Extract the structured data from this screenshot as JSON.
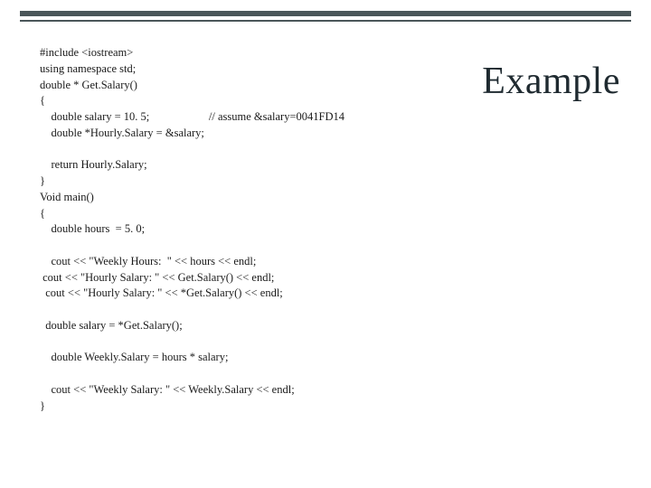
{
  "slide": {
    "title": "Example",
    "code_lines": [
      "#include <iostream>",
      "using namespace std;",
      "double * Get.Salary()",
      "{",
      "    double salary = 10. 5;                     // assume &salary=0041FD14",
      "    double *Hourly.Salary = &salary;",
      "",
      "    return Hourly.Salary;",
      "}",
      "Void main()",
      "{",
      "    double hours  = 5. 0;",
      "",
      "    cout << \"Weekly Hours:  \" << hours << endl;",
      " cout << \"Hourly Salary: \" << Get.Salary() << endl;",
      "  cout << \"Hourly Salary: \" << *Get.Salary() << endl;",
      "",
      "  double salary = *Get.Salary();",
      "",
      "    double Weekly.Salary = hours * salary;",
      "",
      "    cout << \"Weekly Salary: \" << Weekly.Salary << endl;",
      "}"
    ]
  }
}
